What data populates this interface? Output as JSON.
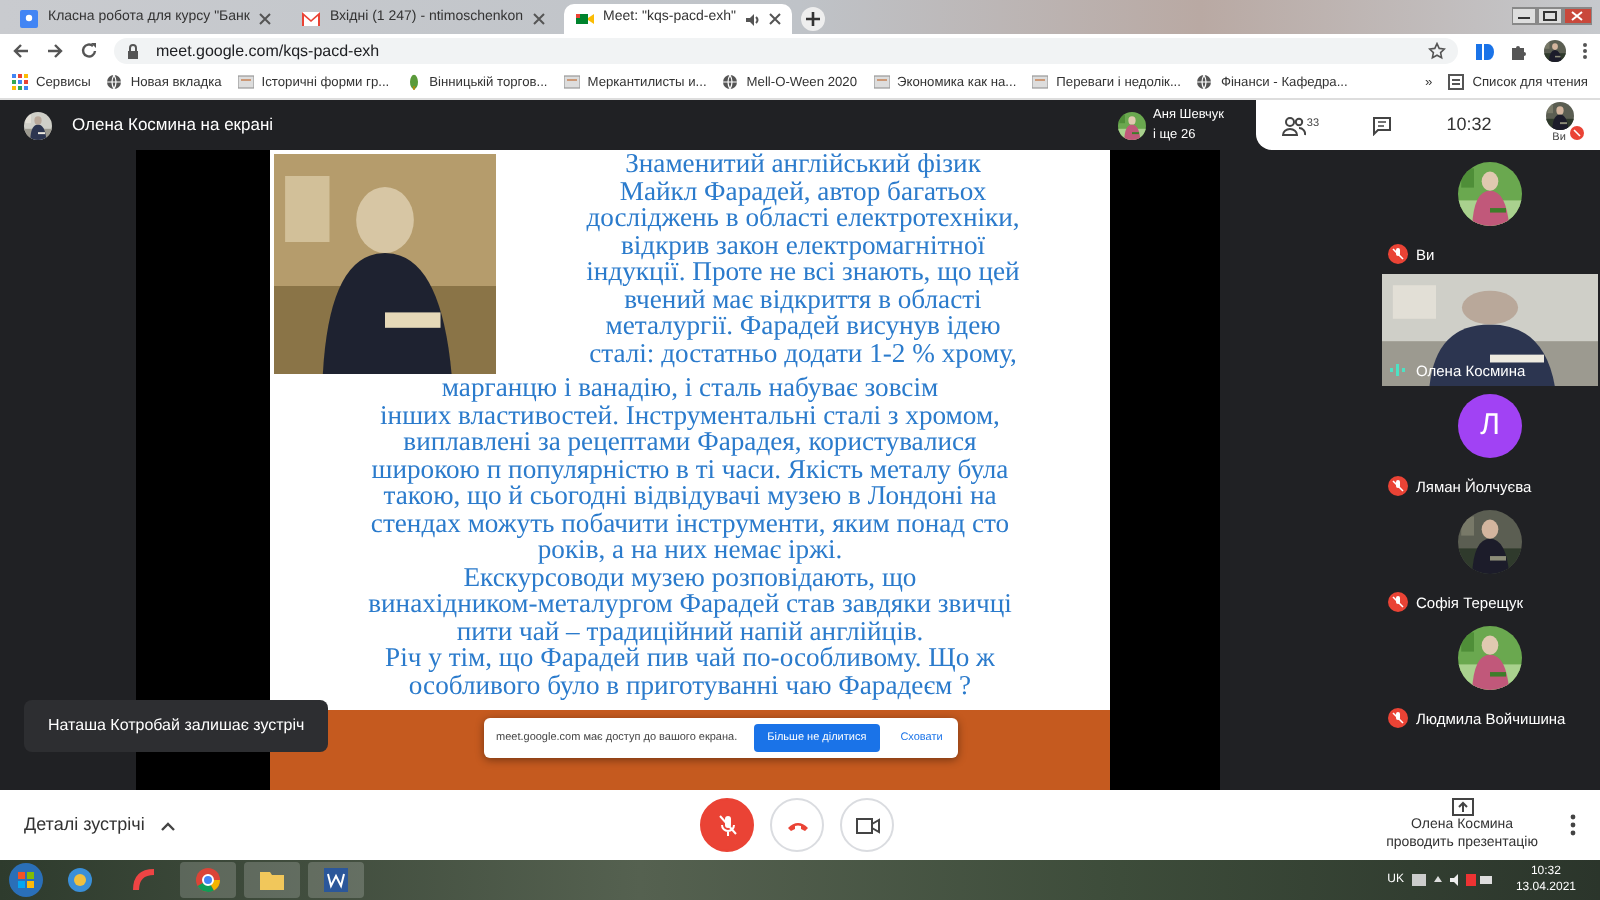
{
  "browser": {
    "tabs": [
      {
        "kind": "classroom",
        "title": "Класна робота для курсу \"Банк",
        "selected": false,
        "audio": false
      },
      {
        "kind": "gmail",
        "title": "Вхідні (1 247) - ntimoschenkon",
        "selected": false,
        "audio": false
      },
      {
        "kind": "meet",
        "title": "Meet: \"kqs-pacd-exh\"",
        "selected": true,
        "audio": true
      }
    ],
    "url": "meet.google.com/kqs-pacd-exh",
    "bookmarks": [
      {
        "kind": "apps",
        "label": "Сервисы"
      },
      {
        "kind": "globe",
        "label": "Новая вкладка"
      },
      {
        "kind": "page",
        "label": "Історичні форми гр..."
      },
      {
        "kind": "leaf",
        "label": "Вінницькій торгов..."
      },
      {
        "kind": "page",
        "label": "Меркантилисты и..."
      },
      {
        "kind": "globe",
        "label": "Mell-O-Ween 2020"
      },
      {
        "kind": "page",
        "label": "Экономика как на..."
      },
      {
        "kind": "page",
        "label": "Переваги і недолік..."
      },
      {
        "kind": "globe",
        "label": "Фінанси - Кафедра..."
      }
    ],
    "bookmarks_more": "»",
    "reading_list": "Список для чтения"
  },
  "meet": {
    "presenter_label": "Олена Космина на екрані",
    "header_participant": {
      "name": "Аня Шевчук",
      "more": "і ще 26"
    },
    "people_count": "33",
    "clock": "10:32",
    "self_label": "Ви",
    "slide": {
      "lines_beside_picture": [
        "Знаменитий англійський фізик",
        "Майкл Фарадей, автор   багатьох",
        "досліджень в області електротехніки,",
        "відкрив закон електромагнітної",
        "індукції. Проте не всі знають, що цей",
        "вчений має відкриття  в області",
        "металургії. Фарадей висунув ідею",
        "сталі: достатньо додати 1-2 % хрому,"
      ],
      "lines": [
        "марганцю і ванадію, і сталь набуває зовсім",
        "інших властивостей. Інструментальні сталі з хромом,",
        "виплавлені  за рецептами Фарадея, користувалися",
        "широкою п  популярністю в ті часи. Якість металу була",
        "такою, що й сьогодні відвідувачі музею в Лондоні  на",
        "стендах можуть побачити інструменти, яким понад сто",
        "років, а на них немає іржі.",
        "Екскурсоводи  музею розповідають, що",
        "винахідником-металургом Фарадей став завдяки звичці",
        "пити чай – традиційний напій англійців.",
        "Річ у тім, що Фарадей пив чай по-особливому. Що ж",
        "особливого було в приготуванні чаю Фарадеєм ?"
      ]
    },
    "participants": [
      {
        "name": "Ви",
        "muted": true
      },
      {
        "kind": "video",
        "name": "Олена Космина",
        "muted": false
      },
      {
        "kind": "letter",
        "letter": "Л",
        "name": "Ляман Йолчуєва",
        "muted": true
      },
      {
        "name": "Софія Терещук",
        "muted": true
      },
      {
        "name": "Людмила Войчишина",
        "muted": true
      }
    ],
    "toast": "Наташа Котробай залишає зустріч",
    "share_bar": {
      "message": "meet.google.com має доступ до вашого екрана.",
      "stop_button": "Більше не ділитися",
      "hide_button": "Сховати"
    },
    "controls": {
      "details": "Деталі зустрічі",
      "mic_muted": true,
      "presenter_note": [
        "Олена Космина",
        "проводить презентацію"
      ]
    }
  },
  "taskbar": {
    "language": "UK",
    "time": "10:32",
    "date": "13.04.2021"
  }
}
